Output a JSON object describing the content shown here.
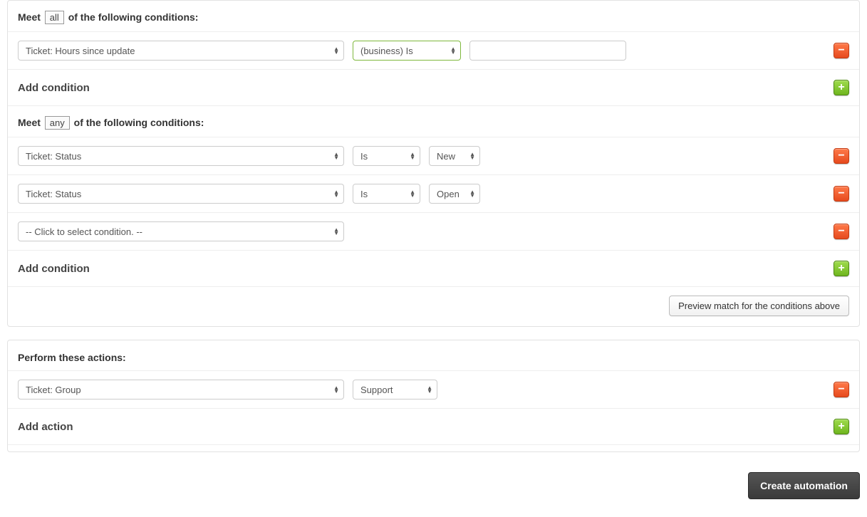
{
  "conditions": {
    "all": {
      "header_pre": "Meet",
      "qualifier": "all",
      "header_post": "of the following conditions:",
      "rows": [
        {
          "field": "Ticket: Hours since update",
          "operator": "(business) Is",
          "operator_highlight": true,
          "value": "",
          "value_type": "text"
        }
      ],
      "add_label": "Add condition"
    },
    "any": {
      "header_pre": "Meet",
      "qualifier": "any",
      "header_post": "of the following conditions:",
      "rows": [
        {
          "field": "Ticket: Status",
          "operator": "Is",
          "value": "New",
          "value_type": "select"
        },
        {
          "field": "Ticket: Status",
          "operator": "Is",
          "value": "Open",
          "value_type": "select"
        },
        {
          "field": "-- Click to select condition. --"
        }
      ],
      "add_label": "Add condition"
    },
    "preview_label": "Preview match for the conditions above"
  },
  "actions": {
    "header": "Perform these actions:",
    "rows": [
      {
        "field": "Ticket: Group",
        "value": "Support"
      }
    ],
    "add_label": "Add action"
  },
  "footer": {
    "submit_label": "Create automation"
  },
  "glyphs": {
    "minus": "−",
    "plus": "+",
    "up": "▲",
    "down": "▼"
  }
}
